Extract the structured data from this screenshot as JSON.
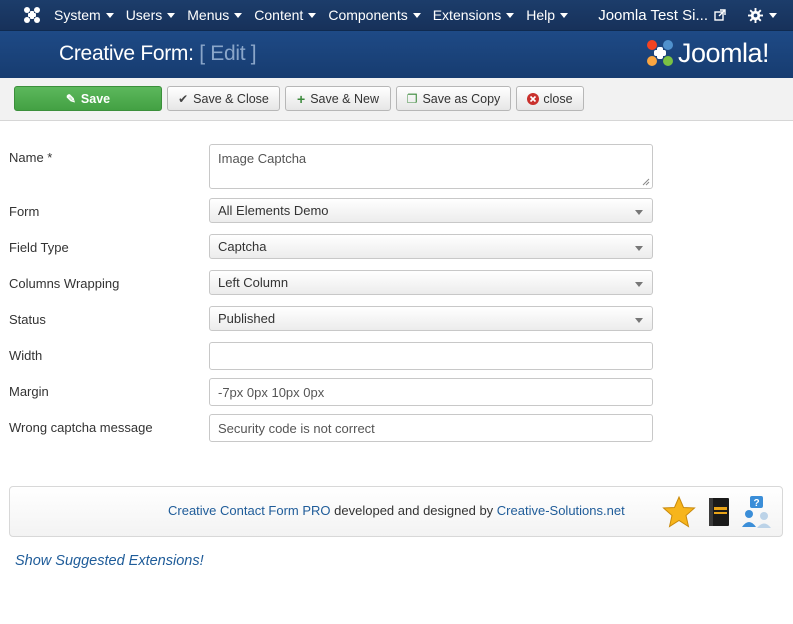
{
  "navbar": {
    "menus": [
      "System",
      "Users",
      "Menus",
      "Content",
      "Components",
      "Extensions",
      "Help"
    ],
    "site_name": "Joomla Test Si..."
  },
  "header": {
    "title": "Creative Form:",
    "subtitle": "[ Edit ]",
    "brand": "Joomla!"
  },
  "toolbar": {
    "save": "Save",
    "save_close": "Save & Close",
    "save_new": "Save & New",
    "save_copy": "Save as Copy",
    "close": "close"
  },
  "form": {
    "name_label": "Name *",
    "name_value": "Image Captcha",
    "form_label": "Form",
    "form_value": "All Elements Demo",
    "field_type_label": "Field Type",
    "field_type_value": "Captcha",
    "columns_label": "Columns Wrapping",
    "columns_value": "Left Column",
    "status_label": "Status",
    "status_value": "Published",
    "width_label": "Width",
    "width_value": "",
    "margin_label": "Margin",
    "margin_value": "-7px 0px 10px 0px",
    "wrong_label": "Wrong captcha message",
    "wrong_value": "Security code is not correct"
  },
  "promo": {
    "product": "Creative Contact Form PRO",
    "middle": " developed and designed by ",
    "company": "Creative-Solutions.net"
  },
  "suggest": "Show Suggested Extensions!",
  "colors": {
    "navbar": "#1c3d6b",
    "header": "#1e4a86",
    "save_green": "#5cb85c",
    "link_blue": "#1f5c99"
  }
}
